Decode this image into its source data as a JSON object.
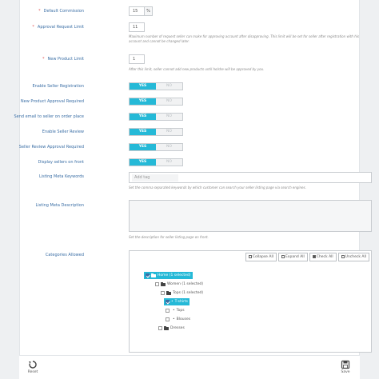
{
  "form": {
    "default_commission": {
      "label": "Default Commission",
      "value": "15",
      "addon": "%"
    },
    "approval_request_limit": {
      "label": "Approval Request Limit",
      "value": "11",
      "help": "Maximum number of request seller can make for approving account after disapproving. This limit will be set for seller after registration with his account and cannot be changed later."
    },
    "new_product_limit": {
      "label": "New Product Limit",
      "value": "1",
      "help": "After this limit, seller cannot add new products until he/she will be approved by you."
    },
    "toggles": [
      {
        "label": "Enable Seller Registration",
        "yes": "YES",
        "no": "NO",
        "value": "YES"
      },
      {
        "label": "New Product Approval Required",
        "yes": "YES",
        "no": "NO",
        "value": "YES"
      },
      {
        "label": "Send email to seller on order place",
        "yes": "YES",
        "no": "NO",
        "value": "YES"
      },
      {
        "label": "Enable Seller Review",
        "yes": "YES",
        "no": "NO",
        "value": "YES"
      },
      {
        "label": "Seller Review Approval Required",
        "yes": "YES",
        "no": "NO",
        "value": "YES"
      },
      {
        "label": "Display sellers on front",
        "yes": "YES",
        "no": "NO",
        "value": "YES"
      }
    ],
    "listing_meta_keywords": {
      "label": "Listing Meta Keywords",
      "placeholder": "Add tag",
      "help": "Set the comma separated keywords by which customer can search your seller listing page via search engines."
    },
    "listing_meta_description": {
      "label": "Listing Meta Description",
      "help": "Set the description for seller listing page on front."
    },
    "categories": {
      "label": "Categories Allowed",
      "buttons": {
        "collapse": "Collapse All",
        "expand": "Expand All",
        "check": "Check All",
        "uncheck": "Uncheck All"
      },
      "nodes": [
        {
          "label": "Home (1 selected)",
          "checked": true,
          "selected": true,
          "folder": true
        },
        {
          "label": "Women (1 selected)",
          "checked": false,
          "selected": false,
          "folder": true
        },
        {
          "label": "Tops (1 selected)",
          "checked": false,
          "selected": false,
          "folder": true
        },
        {
          "label": "T-shirts",
          "checked": true,
          "selected": true,
          "folder": false,
          "bullet": "•"
        },
        {
          "label": "Tops",
          "checked": false,
          "selected": false,
          "folder": false,
          "bullet": "•"
        },
        {
          "label": "Blouses",
          "checked": false,
          "selected": false,
          "folder": false,
          "bullet": "•"
        },
        {
          "label": "Dresses",
          "checked": false,
          "selected": false,
          "folder": true
        }
      ]
    }
  },
  "footer": {
    "reset_label": "Reset",
    "save_label": "Save"
  },
  "icons": {
    "reset": "reset-icon",
    "save": "save-icon"
  },
  "colors": {
    "accent": "#25b9d7",
    "label": "#3a6ea5",
    "required": "#e05555"
  }
}
